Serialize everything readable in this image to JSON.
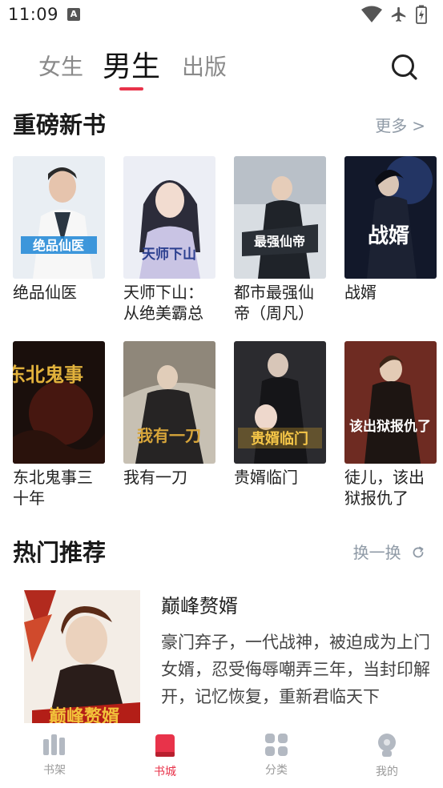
{
  "status_bar": {
    "time": "11:09",
    "app_icon_letter": "A"
  },
  "top_tabs": [
    {
      "label": "女生",
      "active": false
    },
    {
      "label": "男生",
      "active": true
    },
    {
      "label": "出版",
      "active": false
    }
  ],
  "new_books": {
    "title": "重磅新书",
    "more_label": "更多",
    "books": [
      {
        "title": "绝品仙医",
        "cover_text": "绝品仙医"
      },
      {
        "title": "天师下山：从绝美霸总",
        "cover_text": "天师下山"
      },
      {
        "title": "都市最强仙帝（周凡）",
        "cover_text": "最强仙帝"
      },
      {
        "title": "战婿",
        "cover_text": "战婿"
      },
      {
        "title": "东北鬼事三十年",
        "cover_text": "东北鬼事"
      },
      {
        "title": "我有一刀",
        "cover_text": "我有一刀"
      },
      {
        "title": "贵婿临门",
        "cover_text": "贵婿临门"
      },
      {
        "title": "徒儿，该出狱报仇了",
        "cover_text": "该出狱报仇了"
      }
    ]
  },
  "hot": {
    "title": "热门推荐",
    "refresh_label": "换一换",
    "featured": {
      "title": "巅峰赘婿",
      "description": "豪门弃子，一代战神，被迫成为上门女婿，忍受侮辱嘲弄三年，当封印解开，记忆恢复，重新君临天下",
      "cover_text": "巅峰赘婿"
    }
  },
  "bottom_nav": [
    {
      "label": "书架",
      "icon": "bookshelf-icon",
      "active": false
    },
    {
      "label": "书城",
      "icon": "bookstore-icon",
      "active": true
    },
    {
      "label": "分类",
      "icon": "category-icon",
      "active": false
    },
    {
      "label": "我的",
      "icon": "profile-icon",
      "active": false
    }
  ],
  "colors": {
    "accent": "#e8334a",
    "muted": "#8f9aa6",
    "nav_inactive": "#b3b9c2"
  }
}
